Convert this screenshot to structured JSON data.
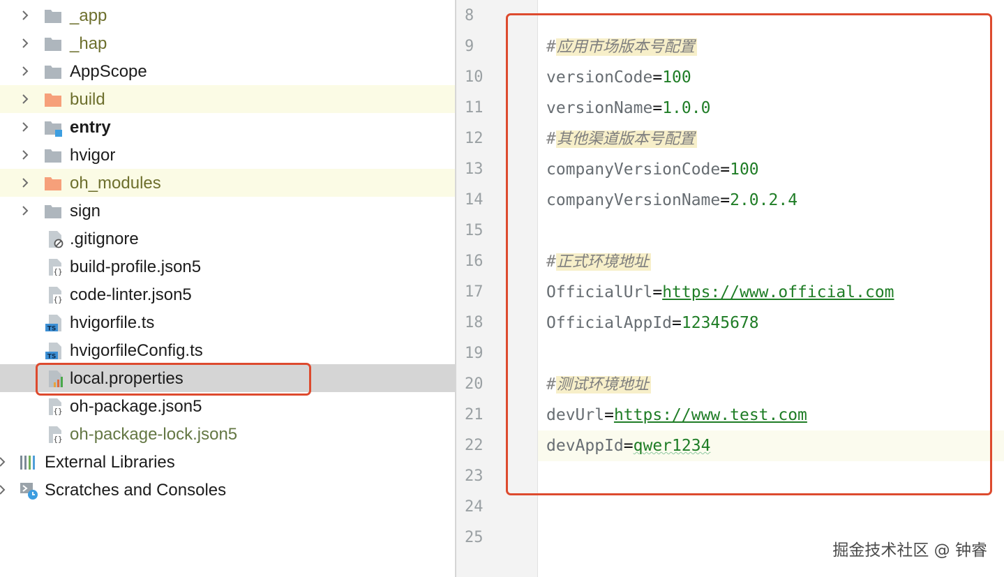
{
  "project_tree": {
    "items": [
      {
        "label": "_app",
        "kind": "folder",
        "icon": "folder-icon"
      },
      {
        "label": "_hap",
        "kind": "folder",
        "icon": "folder-icon"
      },
      {
        "label": "AppScope",
        "kind": "folder",
        "icon": "folder-icon"
      },
      {
        "label": "build",
        "kind": "folder-excluded",
        "icon": "excluded-folder-icon"
      },
      {
        "label": "entry",
        "kind": "module",
        "icon": "module-folder-icon"
      },
      {
        "label": "hvigor",
        "kind": "folder",
        "icon": "folder-icon"
      },
      {
        "label": "oh_modules",
        "kind": "folder-excluded",
        "icon": "excluded-folder-icon"
      },
      {
        "label": "sign",
        "kind": "folder",
        "icon": "folder-icon"
      },
      {
        "label": ".gitignore",
        "kind": "file",
        "icon": "gitignore-file-icon"
      },
      {
        "label": "build-profile.json5",
        "kind": "file",
        "icon": "json-file-icon"
      },
      {
        "label": "code-linter.json5",
        "kind": "file",
        "icon": "json-file-icon"
      },
      {
        "label": "hvigorfile.ts",
        "kind": "file",
        "icon": "typescript-file-icon"
      },
      {
        "label": "hvigorfileConfig.ts",
        "kind": "file",
        "icon": "typescript-file-icon"
      },
      {
        "label": "local.properties",
        "kind": "file",
        "icon": "properties-file-icon",
        "selected": true
      },
      {
        "label": "oh-package.json5",
        "kind": "file",
        "icon": "json-file-icon"
      },
      {
        "label": "oh-package-lock.json5",
        "kind": "file",
        "icon": "json-file-icon"
      },
      {
        "label": "External Libraries",
        "kind": "special",
        "icon": "libraries-icon"
      },
      {
        "label": "Scratches and Consoles",
        "kind": "special",
        "icon": "scratches-icon"
      }
    ]
  },
  "editor": {
    "file": "local.properties",
    "line_numbers": [
      "8",
      "9",
      "10",
      "11",
      "12",
      "13",
      "14",
      "15",
      "16",
      "17",
      "18",
      "19",
      "20",
      "21",
      "22",
      "23",
      "24",
      "25"
    ],
    "lines": {
      "l9": {
        "comment": "#",
        "comment_text": "应用市场版本号配置"
      },
      "l10": {
        "key": "versionCode",
        "value": "100"
      },
      "l11": {
        "key": "versionName",
        "value": "1.0.0"
      },
      "l12": {
        "comment": "#",
        "comment_text": "其他渠道版本号配置"
      },
      "l13": {
        "key": "companyVersionCode",
        "value": "100"
      },
      "l14": {
        "key": "companyVersionName",
        "value": "2.0.2.4"
      },
      "l16": {
        "comment": "#",
        "comment_text": "正式环境地址"
      },
      "l17": {
        "key": "OfficialUrl",
        "value": "https://www.official.com"
      },
      "l18": {
        "key": "OfficialAppId",
        "value": "12345678"
      },
      "l20": {
        "comment": "#",
        "comment_text": "测试环境地址"
      },
      "l21": {
        "key": "devUrl",
        "value": "https://www.test.com"
      },
      "l22": {
        "key": "devAppId",
        "value": "qwer1234"
      }
    },
    "equals": "="
  },
  "watermark": "掘金技术社区 @ 钟睿",
  "colors": {
    "annotation_red": "#dd4a2e",
    "value_green": "#1f7d26",
    "key_gray": "#676d72",
    "excluded_folder_orange": "#f6a07a",
    "folder_gray": "#aeb6bd"
  }
}
